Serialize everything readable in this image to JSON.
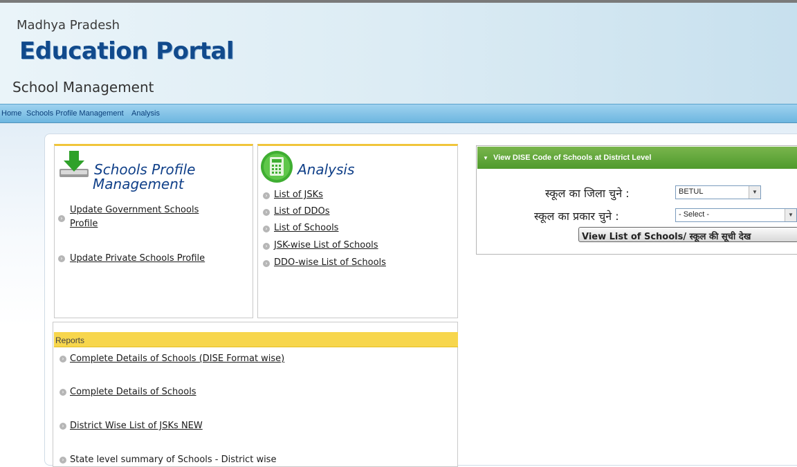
{
  "header": {
    "state": "Madhya Pradesh",
    "portal": "Education Portal",
    "subtitle": "School Management"
  },
  "nav": {
    "home": "Home",
    "profile": "Schools Profile Management",
    "analysis": "Analysis"
  },
  "profile_panel": {
    "title_line1": "Schools Profile",
    "title_line2": "Management",
    "icon": "download-icon",
    "links": {
      "update_govt_line1": "Update Government Schools",
      "update_govt_line2": "Profile",
      "update_private": "Update Private Schools Profile"
    }
  },
  "analysis_panel": {
    "title": "Analysis",
    "icon": "calculator-icon",
    "links": [
      "List of JSKs",
      "List of DDOs",
      "List of Schools",
      "JSK-wise List of Schools",
      "DDO-wise List of Schools"
    ]
  },
  "reports": {
    "header": "Reports",
    "links": [
      "Complete Details of Schools (DISE Format wise)",
      "Complete Details of Schools",
      "District Wise List of JSKs NEW",
      "State level summary of Schools - District wise"
    ]
  },
  "dise": {
    "header": "View DISE Code of Schools at District Level",
    "district_label": "स्कूल का जिला चुने :",
    "district_value": "BETUL",
    "type_label": "स्कूल का प्रकार चुने :",
    "type_value": "- Select -",
    "button": "View List of Schools/ स्कूल की सूची देख"
  },
  "colors": {
    "nav_bar": "#6db6e0",
    "title_blue": "#114a8c",
    "report_header": "#f7d64d",
    "dise_header": "#4f9a2d"
  }
}
